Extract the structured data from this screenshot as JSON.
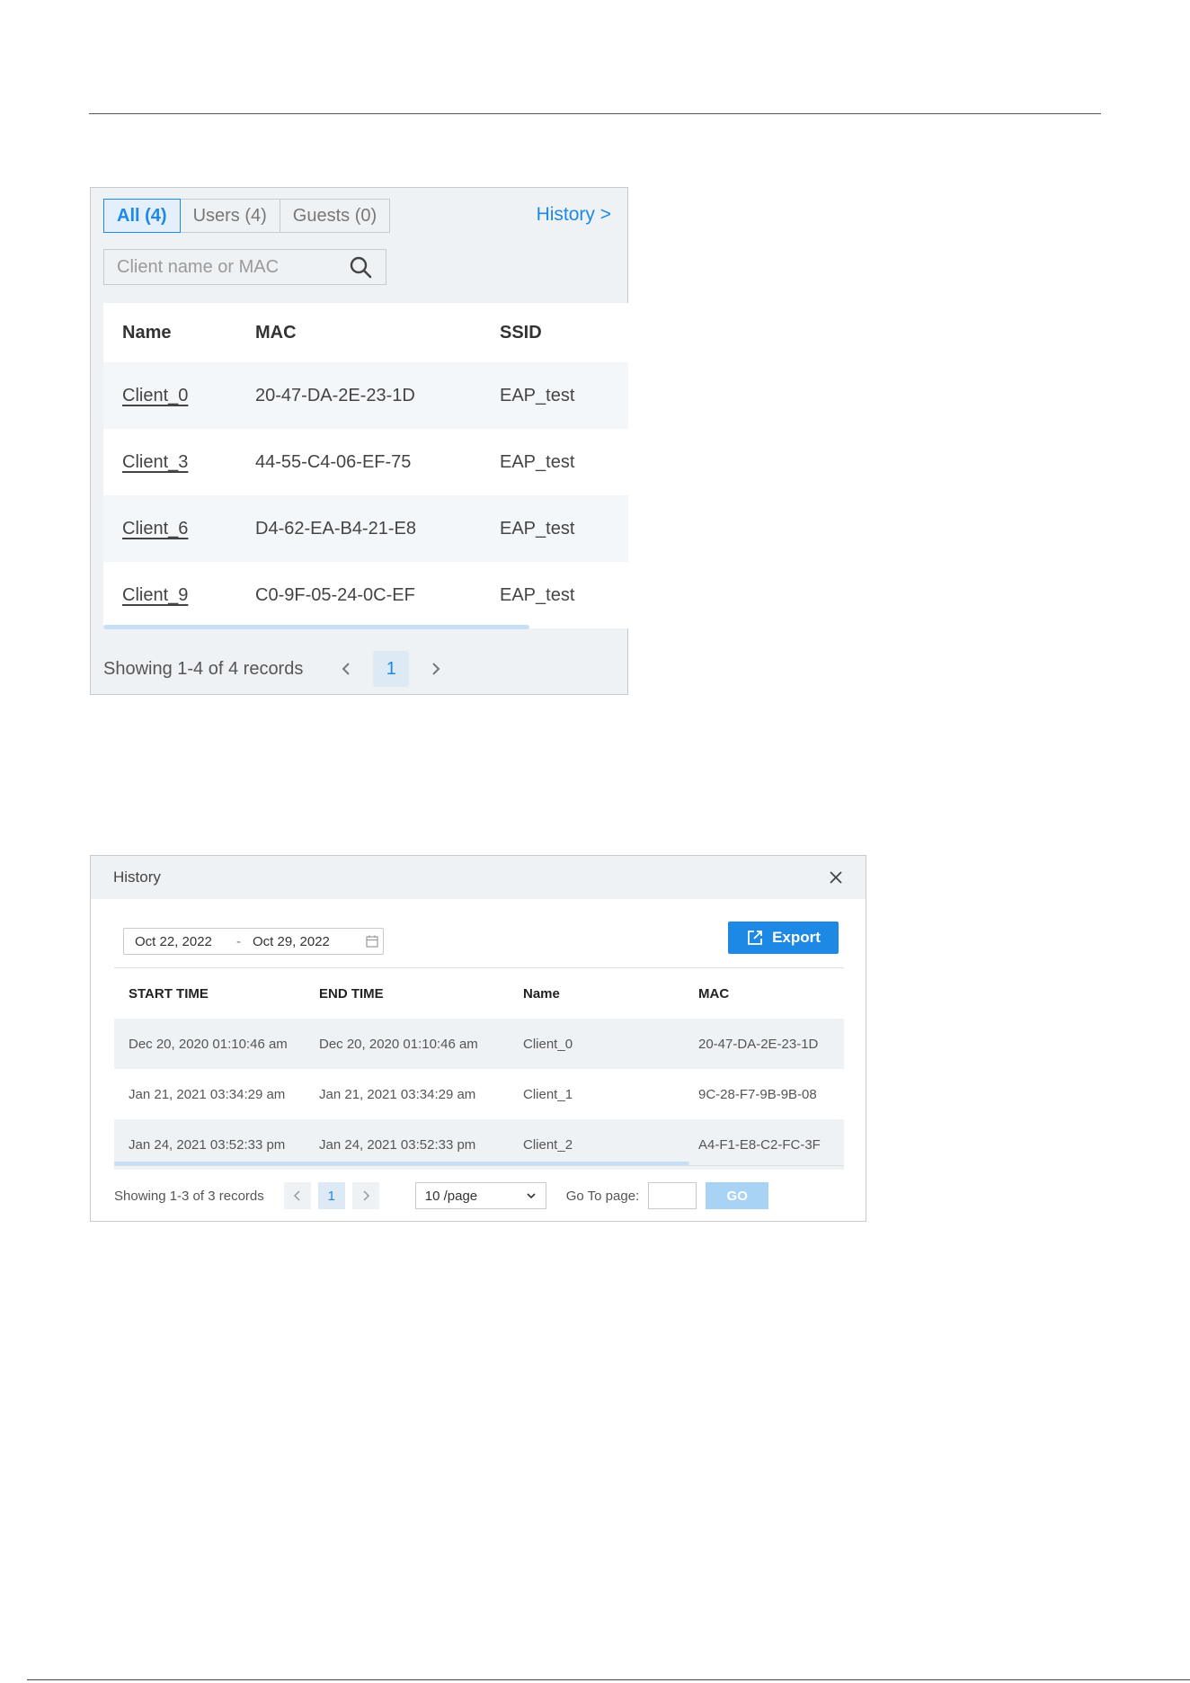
{
  "clients_panel": {
    "tabs": [
      {
        "label": "All (4)",
        "active": true
      },
      {
        "label": "Users (4)",
        "active": false
      },
      {
        "label": "Guests (0)",
        "active": false
      }
    ],
    "history_link": "History >",
    "search": {
      "placeholder": "Client name or MAC",
      "icon": "search-icon"
    },
    "columns": [
      "Name",
      "MAC",
      "SSID"
    ],
    "rows": [
      {
        "name": "Client_0",
        "mac": "20-47-DA-2E-23-1D",
        "ssid": "EAP_test"
      },
      {
        "name": "Client_3",
        "mac": "44-55-C4-06-EF-75",
        "ssid": "EAP_test"
      },
      {
        "name": "Client_6",
        "mac": "D4-62-EA-B4-21-E8",
        "ssid": "EAP_test"
      },
      {
        "name": "Client_9",
        "mac": "C0-9F-05-24-0C-EF",
        "ssid": "EAP_test"
      }
    ],
    "footer": {
      "showing": "Showing 1-4 of 4 records",
      "page": "1"
    }
  },
  "history_dialog": {
    "title": "History",
    "date_range": {
      "start": "Oct 22, 2022",
      "separator": "-",
      "end": "Oct 29, 2022"
    },
    "export_label": "Export",
    "columns": [
      "START TIME",
      "END TIME",
      "Name",
      "MAC"
    ],
    "rows": [
      {
        "start": "Dec 20, 2020 01:10:46 am",
        "end": "Dec 20, 2020 01:10:46 am",
        "name": "Client_0",
        "mac": "20-47-DA-2E-23-1D"
      },
      {
        "start": "Jan 21, 2021 03:34:29 am",
        "end": "Jan 21, 2021 03:34:29 am",
        "name": "Client_1",
        "mac": "9C-28-F7-9B-9B-08"
      },
      {
        "start": "Jan 24, 2021 03:52:33 pm",
        "end": "Jan 24, 2021 03:52:33 pm",
        "name": "Client_2",
        "mac": "A4-F1-E8-C2-FC-3F"
      }
    ],
    "footer": {
      "showing": "Showing 1-3 of 3 records",
      "page": "1",
      "per_page": "10 /page",
      "goto_label": "Go To page:",
      "go_label": "GO"
    }
  },
  "colors": {
    "accent": "#1e88e5",
    "panel_bg": "#eef2f5",
    "go_disabled": "#a9d3f5"
  }
}
